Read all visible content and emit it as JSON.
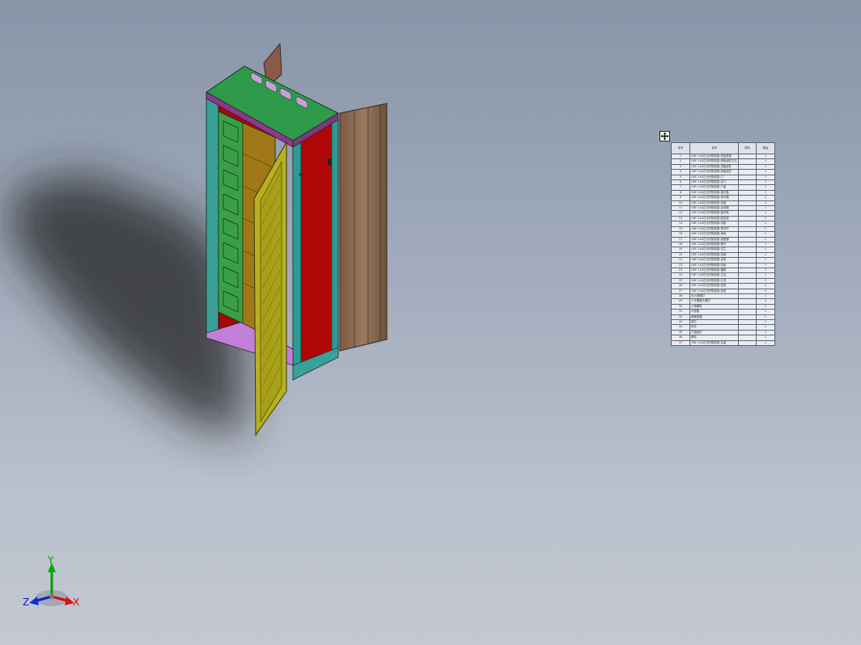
{
  "bom": {
    "headers": [
      "序号",
      "名称",
      "材料",
      "数量"
    ],
    "rows": [
      {
        "no": "1",
        "name": "ODF-144芯光纤配线架-机柜框架",
        "mat": "",
        "qty": "1"
      },
      {
        "no": "2",
        "name": "ODF-144芯光纤配线架-侧板组件左右",
        "mat": "",
        "qty": "1"
      },
      {
        "no": "3",
        "name": "ODF-144芯光纤配线架-顶板组件",
        "mat": "",
        "qty": "1"
      },
      {
        "no": "4",
        "name": "ODF-144芯光纤配线架-底板组件",
        "mat": "",
        "qty": "1"
      },
      {
        "no": "5",
        "name": "ODF-144芯光纤配线架-门",
        "mat": "",
        "qty": "1"
      },
      {
        "no": "6",
        "name": "ODF-144芯光纤配线架-后门",
        "mat": "",
        "qty": "1"
      },
      {
        "no": "7",
        "name": "ODF-144芯光纤配线架-门锁",
        "mat": "",
        "qty": "1"
      },
      {
        "no": "8",
        "name": "ODF-144芯光纤配线架-熔纤盘",
        "mat": "",
        "qty": "1"
      },
      {
        "no": "9",
        "name": "ODF-144芯光纤配线架-单元箱",
        "mat": "",
        "qty": "1"
      },
      {
        "no": "10",
        "name": "ODF-144芯光纤配线架-托盘",
        "mat": "",
        "qty": "1"
      },
      {
        "no": "11",
        "name": "ODF-144芯光纤配线架-走线槽",
        "mat": "",
        "qty": "1"
      },
      {
        "no": "12",
        "name": "ODF-144芯光纤配线架-盘纤架",
        "mat": "",
        "qty": "1"
      },
      {
        "no": "13",
        "name": "ODF-144芯光纤配线架-固定座",
        "mat": "",
        "qty": "1"
      },
      {
        "no": "14",
        "name": "ODF-144芯光纤配线架-挡板",
        "mat": "",
        "qty": "1"
      },
      {
        "no": "15",
        "name": "ODF-144芯光纤配线架-导纤环",
        "mat": "",
        "qty": "1"
      },
      {
        "no": "16",
        "name": "ODF-144芯光纤配线架-接地",
        "mat": "",
        "qty": "1"
      },
      {
        "no": "17",
        "name": "ODF-144芯光纤配线架-适配器",
        "mat": "",
        "qty": "1"
      },
      {
        "no": "18",
        "name": "ODF-144芯光纤配线架-尾纤",
        "mat": "",
        "qty": "1"
      },
      {
        "no": "19",
        "name": "ODF-144芯光纤配线架-法兰",
        "mat": "",
        "qty": "1"
      },
      {
        "no": "20",
        "name": "ODF-144芯光纤配线架-铰链",
        "mat": "",
        "qty": "1"
      },
      {
        "no": "21",
        "name": "ODF-144芯光纤配线架-支架",
        "mat": "",
        "qty": "1"
      },
      {
        "no": "22",
        "name": "ODF-144芯光纤配线架-压板",
        "mat": "",
        "qty": "1"
      },
      {
        "no": "23",
        "name": "ODF-144芯光纤配线架-横梁",
        "mat": "",
        "qty": "1"
      },
      {
        "no": "24",
        "name": "ODF-144芯光纤配线架-立柱",
        "mat": "",
        "qty": "1"
      },
      {
        "no": "25",
        "name": "ODF-144芯光纤配线架-扎带",
        "mat": "",
        "qty": "1"
      },
      {
        "no": "26",
        "name": "ODF-144芯光纤配线架-线夹",
        "mat": "",
        "qty": "1"
      },
      {
        "no": "27",
        "name": "ODF-144芯光纤配线架-标签",
        "mat": "",
        "qty": "4"
      },
      {
        "no": "28",
        "name": "内六角螺钉",
        "mat": "",
        "qty": "1"
      },
      {
        "no": "29",
        "name": "十字槽盘头螺钉",
        "mat": "",
        "qty": "1"
      },
      {
        "no": "30",
        "name": "六角螺母",
        "mat": "",
        "qty": "1"
      },
      {
        "no": "31",
        "name": "平垫圈",
        "mat": "",
        "qty": "1"
      },
      {
        "no": "32",
        "name": "弹簧垫圈",
        "mat": "",
        "qty": "1"
      },
      {
        "no": "33",
        "name": "铆钉",
        "mat": "",
        "qty": "1"
      },
      {
        "no": "34",
        "name": "把手",
        "mat": "",
        "qty": "1"
      },
      {
        "no": "35",
        "name": "门锁组件",
        "mat": "",
        "qty": "1"
      },
      {
        "no": "36",
        "name": "脚轮",
        "mat": "",
        "qty": "1"
      },
      {
        "no": "37",
        "name": "ODF-144芯光纤配线架-总装",
        "mat": "",
        "qty": "1"
      }
    ]
  },
  "triad": {
    "y_label": "Y",
    "x_label": "X",
    "z_label": "Z",
    "colors": {
      "y": "#00a000",
      "x": "#d01010",
      "z": "#1020c0"
    }
  },
  "icons": {
    "table_handle": "move-arrows-icon"
  }
}
